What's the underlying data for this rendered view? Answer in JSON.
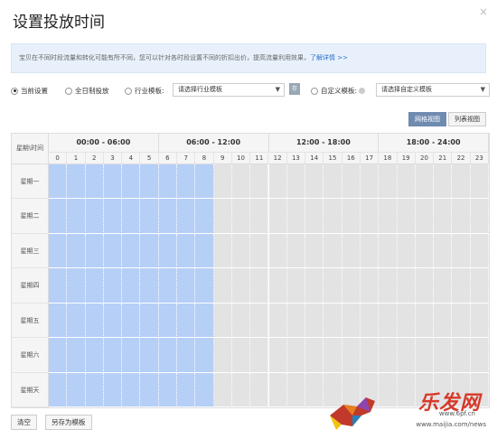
{
  "dialog": {
    "title": "设置投放时间",
    "close": "×"
  },
  "info": {
    "text": "宝贝在不同时段流量和转化可能有所不同，您可以针对各时段设置不同的折扣出价，提高流量利用效果，",
    "link": "了解详情 >>"
  },
  "options": {
    "current": "当前设置",
    "allday": "全日制投放",
    "industry": "行业模板:",
    "industry_select": "请选择行业模板",
    "save_icon": "存",
    "custom": "自定义模板:",
    "custom_select": "请选择自定义模板"
  },
  "views": {
    "grid": "网格视图",
    "list": "列表视图"
  },
  "grid": {
    "corner": "星期\\时间",
    "ranges": [
      "00:00 - 06:00",
      "06:00 - 12:00",
      "12:00 - 18:00",
      "18:00 - 24:00"
    ],
    "hours": [
      "0",
      "1",
      "2",
      "3",
      "4",
      "5",
      "6",
      "7",
      "8",
      "9",
      "10",
      "11",
      "12",
      "13",
      "14",
      "15",
      "16",
      "17",
      "18",
      "19",
      "20",
      "21",
      "22",
      "23"
    ],
    "days": [
      "星期一",
      "星期二",
      "星期三",
      "星期四",
      "星期五",
      "星期六",
      "星期天"
    ],
    "selected_hours_per_day": [
      [
        0,
        1,
        2,
        3,
        4,
        5,
        6,
        7,
        8
      ],
      [
        0,
        1,
        2,
        3,
        4,
        5,
        6,
        7,
        8
      ],
      [
        0,
        1,
        2,
        3,
        4,
        5,
        6,
        7,
        8
      ],
      [
        0,
        1,
        2,
        3,
        4,
        5,
        6,
        7,
        8
      ],
      [
        0,
        1,
        2,
        3,
        4,
        5,
        6,
        7,
        8
      ],
      [
        0,
        1,
        2,
        3,
        4,
        5,
        6,
        7,
        8
      ],
      [
        0,
        1,
        2,
        3,
        4,
        5,
        6,
        7,
        8
      ]
    ],
    "selected_color": "#b5cff7",
    "unselected_color": "#e3e3e3"
  },
  "footer": {
    "clear": "清空",
    "save_template": "另存为模板"
  },
  "watermark": {
    "brand": "乐发网",
    "url": "www.maijia.com/news",
    "url2": "www.6pf.cn"
  }
}
